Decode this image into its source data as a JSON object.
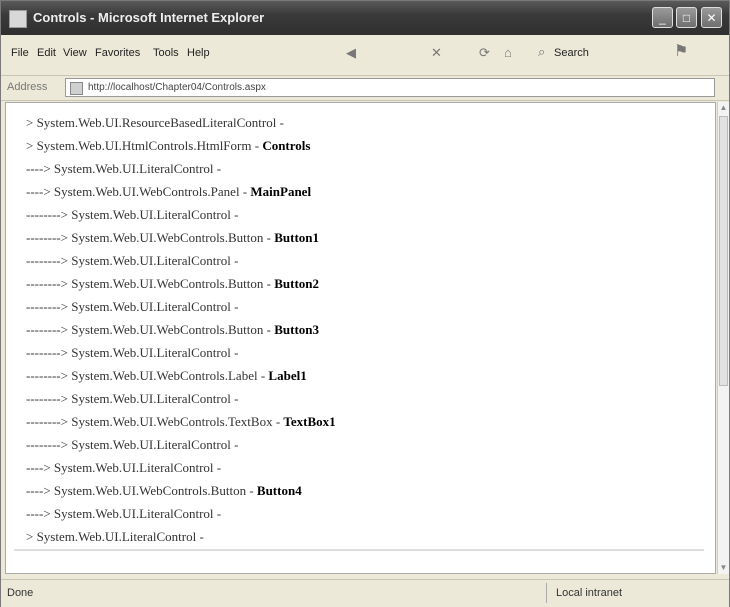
{
  "window": {
    "title": "Controls - Microsoft Internet Explorer"
  },
  "titlebar_buttons": {
    "minimize": "_",
    "maximize": "□",
    "close": "✕"
  },
  "menu": [
    "File",
    "Edit",
    "View",
    "Favorites",
    "Tools",
    "Help"
  ],
  "toolbar": {
    "search_label": "Search"
  },
  "address": {
    "label": "Address",
    "url": "http://localhost/Chapter04/Controls.aspx"
  },
  "content": {
    "lines": [
      {
        "prefix": "> System.Web.UI.ResourceBasedLiteralControl - ",
        "id": ""
      },
      {
        "prefix": "> System.Web.UI.HtmlControls.HtmlForm - ",
        "id": "Controls"
      },
      {
        "prefix": "----> System.Web.UI.LiteralControl - ",
        "id": ""
      },
      {
        "prefix": "----> System.Web.UI.WebControls.Panel - ",
        "id": "MainPanel"
      },
      {
        "prefix": "--------> System.Web.UI.LiteralControl - ",
        "id": ""
      },
      {
        "prefix": "--------> System.Web.UI.WebControls.Button - ",
        "id": "Button1"
      },
      {
        "prefix": "--------> System.Web.UI.LiteralControl - ",
        "id": ""
      },
      {
        "prefix": "--------> System.Web.UI.WebControls.Button - ",
        "id": "Button2"
      },
      {
        "prefix": "--------> System.Web.UI.LiteralControl - ",
        "id": ""
      },
      {
        "prefix": "--------> System.Web.UI.WebControls.Button - ",
        "id": "Button3"
      },
      {
        "prefix": "--------> System.Web.UI.LiteralControl - ",
        "id": ""
      },
      {
        "prefix": "--------> System.Web.UI.WebControls.Label - ",
        "id": "Label1"
      },
      {
        "prefix": "--------> System.Web.UI.LiteralControl - ",
        "id": ""
      },
      {
        "prefix": "--------> System.Web.UI.WebControls.TextBox - ",
        "id": "TextBox1"
      },
      {
        "prefix": "--------> System.Web.UI.LiteralControl - ",
        "id": ""
      },
      {
        "prefix": "----> System.Web.UI.LiteralControl - ",
        "id": ""
      },
      {
        "prefix": "----> System.Web.UI.WebControls.Button - ",
        "id": "Button4"
      },
      {
        "prefix": "----> System.Web.UI.LiteralControl - ",
        "id": ""
      },
      {
        "prefix": "> System.Web.UI.LiteralControl - ",
        "id": ""
      }
    ]
  },
  "status": {
    "left": "Done",
    "zone": "Local intranet"
  }
}
